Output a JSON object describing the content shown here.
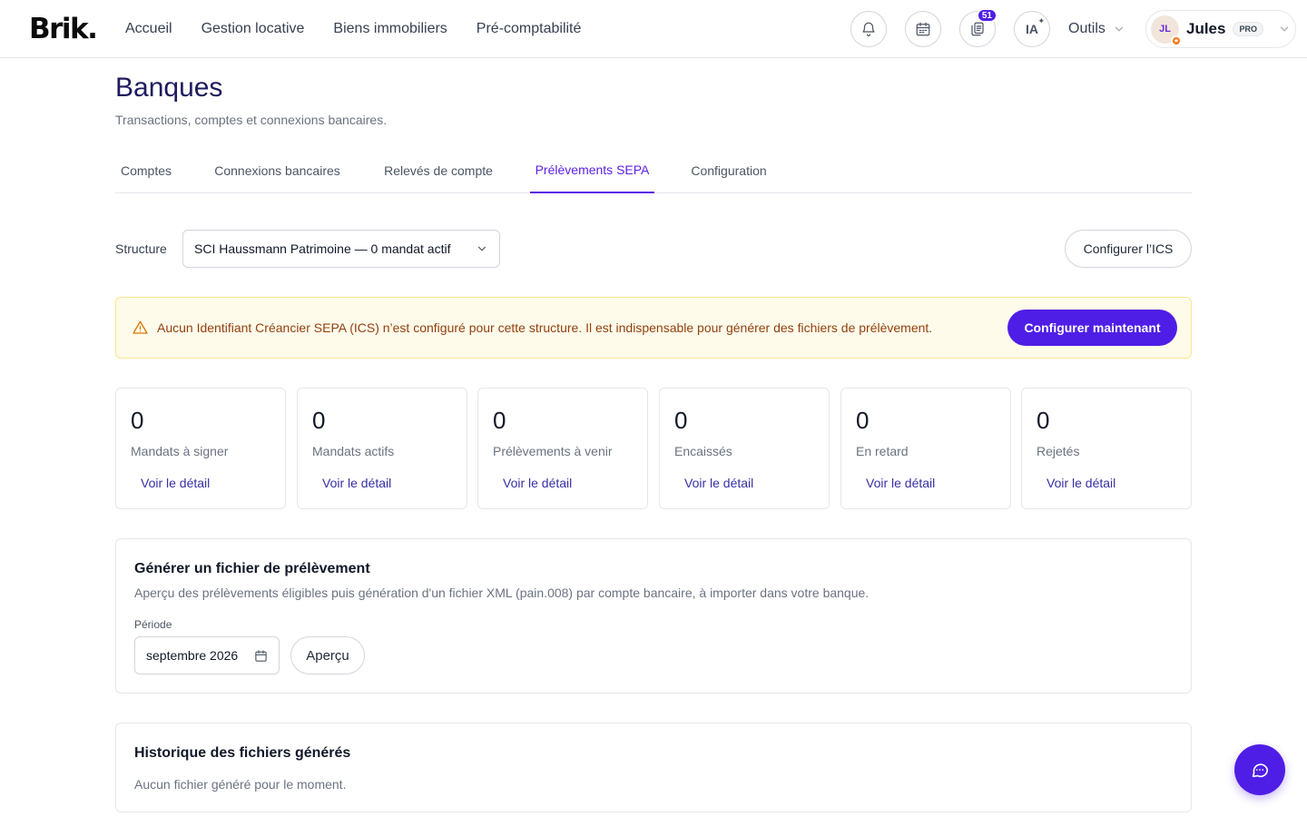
{
  "brand": {
    "logo": "Brik."
  },
  "nav": {
    "items": [
      "Accueil",
      "Gestion locative",
      "Biens immobiliers",
      "Pré-comptabilité"
    ]
  },
  "header": {
    "documents_badge": "51",
    "ia_label": "IA",
    "tools_label": "Outils",
    "user": {
      "initials": "JL",
      "name": "Jules",
      "plan": "PRO"
    }
  },
  "page": {
    "title": "Banques",
    "subtitle": "Transactions, comptes et connexions bancaires."
  },
  "tabs": [
    "Comptes",
    "Connexions bancaires",
    "Relevés de compte",
    "Prélèvements SEPA",
    "Configuration"
  ],
  "active_tab": "Prélèvements SEPA",
  "structure": {
    "label": "Structure",
    "selected": "SCI Haussmann Patrimoine — 0 mandat actif",
    "configure_button": "Configurer l’ICS"
  },
  "alert": {
    "message": "Aucun Identifiant Créancier SEPA (ICS) n’est configuré pour cette structure. Il est indispensable pour générer des fichiers de prélèvement.",
    "action": "Configurer maintenant"
  },
  "stats": [
    {
      "value": "0",
      "label": "Mandats à signer",
      "link": "Voir le détail"
    },
    {
      "value": "0",
      "label": "Mandats actifs",
      "link": "Voir le détail"
    },
    {
      "value": "0",
      "label": "Prélèvements à venir",
      "link": "Voir le détail"
    },
    {
      "value": "0",
      "label": "Encaissés",
      "link": "Voir le détail"
    },
    {
      "value": "0",
      "label": "En retard",
      "link": "Voir le détail"
    },
    {
      "value": "0",
      "label": "Rejetés",
      "link": "Voir le détail"
    }
  ],
  "generate": {
    "title": "Générer un fichier de prélèvement",
    "description": "Aperçu des prélèvements éligibles puis génération d'un fichier XML (pain.008) par compte bancaire, à importer dans votre banque.",
    "period_label": "Période",
    "period_value": "septembre 2026",
    "preview_button": "Aperçu"
  },
  "history": {
    "title": "Historique des fichiers générés",
    "empty": "Aucun fichier généré pour le moment."
  },
  "colors": {
    "accent": "#4f1ee6",
    "title": "#1e1b5e",
    "warning_bg": "#fffbeb",
    "warning_text": "#92400e"
  }
}
